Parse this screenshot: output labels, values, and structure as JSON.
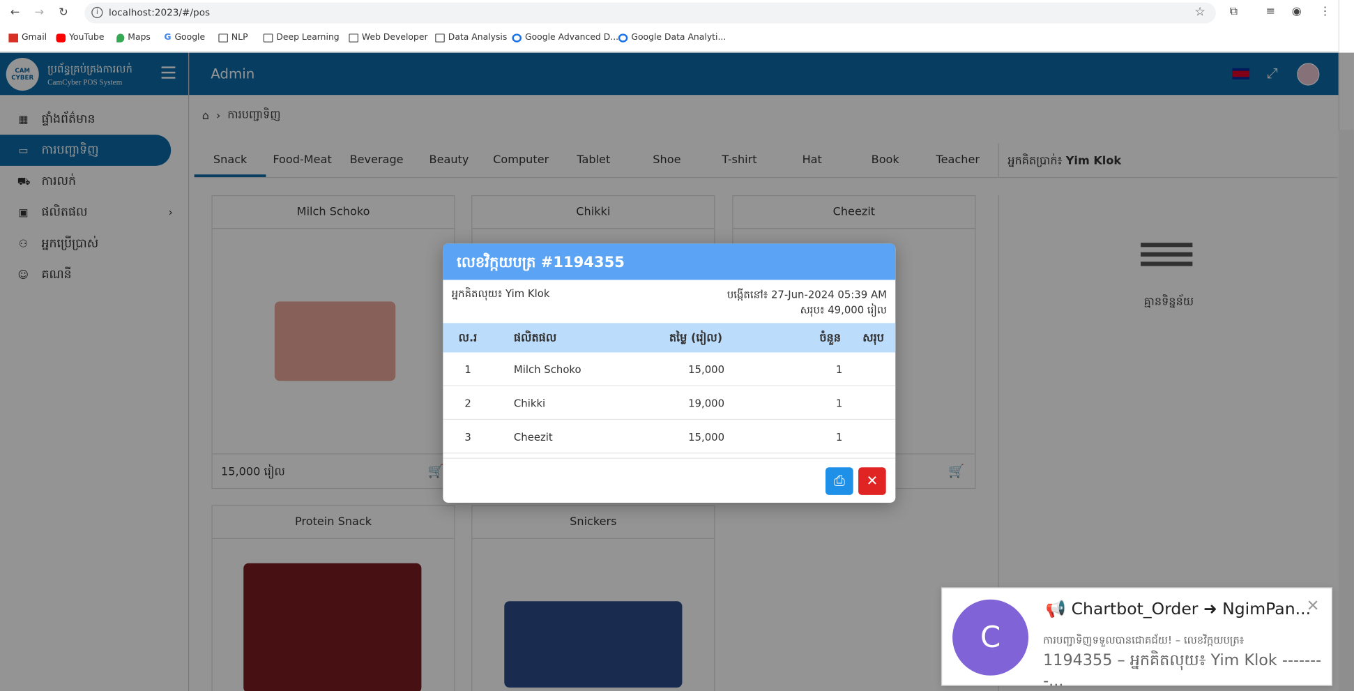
{
  "browser": {
    "url": "localhost:2023/#/pos",
    "bookmarks": [
      "Gmail",
      "YouTube",
      "Maps",
      "Google",
      "NLP",
      "Deep Learning",
      "Web Developer",
      "Data Analysis",
      "Google Advanced D...",
      "Google Data Analyti..."
    ]
  },
  "brand": {
    "title_kh": "ប្រព័ន្ធគ្រប់គ្រងការលក់",
    "title_en": "CamCyber POS System",
    "logo": "CAM CYBER"
  },
  "sidebar": {
    "items": [
      {
        "label": "ផ្ទាំងព័ត៌មាន",
        "icon": "dashboard-icon"
      },
      {
        "label": "ការបញ្ជាទិញ",
        "icon": "monitor-icon"
      },
      {
        "label": "ការលក់",
        "icon": "cart-icon"
      },
      {
        "label": "ផលិតផល",
        "icon": "briefcase-icon"
      },
      {
        "label": "អ្នកប្រើប្រាស់",
        "icon": "users-icon"
      },
      {
        "label": "គណនី",
        "icon": "person-icon"
      }
    ]
  },
  "topbar": {
    "title": "Admin"
  },
  "breadcrumb": {
    "current": "ការបញ្ជាទិញ"
  },
  "tabs": [
    "Snack",
    "Food-Meat",
    "Beverage",
    "Beauty",
    "Computer",
    "Tablet",
    "Shoe",
    "T-shirt",
    "Hat",
    "Book",
    "Teacher"
  ],
  "cashier": {
    "label": "អ្នកគិតប្រាក់៖",
    "name": "Yim Klok"
  },
  "products": [
    {
      "name": "Milch Schoko",
      "price": "15,000 រៀល"
    },
    {
      "name": "Chikki"
    },
    {
      "name": "Cheezit"
    },
    {
      "name": "Protein Snack"
    },
    {
      "name": "Snickers"
    }
  ],
  "empty_panel": {
    "text": "គ្មានទិន្នន័យ"
  },
  "modal": {
    "title": "លេខវិក្កយបត្រ #1194355",
    "cashier": "អ្នកគិតលុយ៖ Yim Klok",
    "created": "បង្កើតនៅ៖ 27-Jun-2024 05:39 AM",
    "total": "សរុប៖ 49,000 រៀល",
    "columns": [
      "ល.រ",
      "ផលិតផល",
      "តម្លៃ (រៀល)",
      "ចំនួន",
      "សរុប"
    ],
    "rows": [
      {
        "no": "1",
        "product": "Milch Schoko",
        "price": "15,000",
        "qty": "1"
      },
      {
        "no": "2",
        "product": "Chikki",
        "price": "19,000",
        "qty": "1"
      },
      {
        "no": "3",
        "product": "Cheezit",
        "price": "15,000",
        "qty": "1"
      }
    ]
  },
  "notification": {
    "avatar": "C",
    "title": "📢 Chartbot_Order ➜ NgimPan...",
    "line1": "ការបញ្ជាទិញទទួលបានជោគជ័យ! – លេខវិក្កយបត្រ៖",
    "line2": "1194355 – អ្នកគិតលុយ៖ Yim Klok --------..."
  },
  "colors": {
    "primary": "#0c6aa6",
    "modal_header": "#5ba4f5",
    "print": "#1e90e8",
    "close": "#e02424",
    "notif_avatar": "#8163d8"
  }
}
